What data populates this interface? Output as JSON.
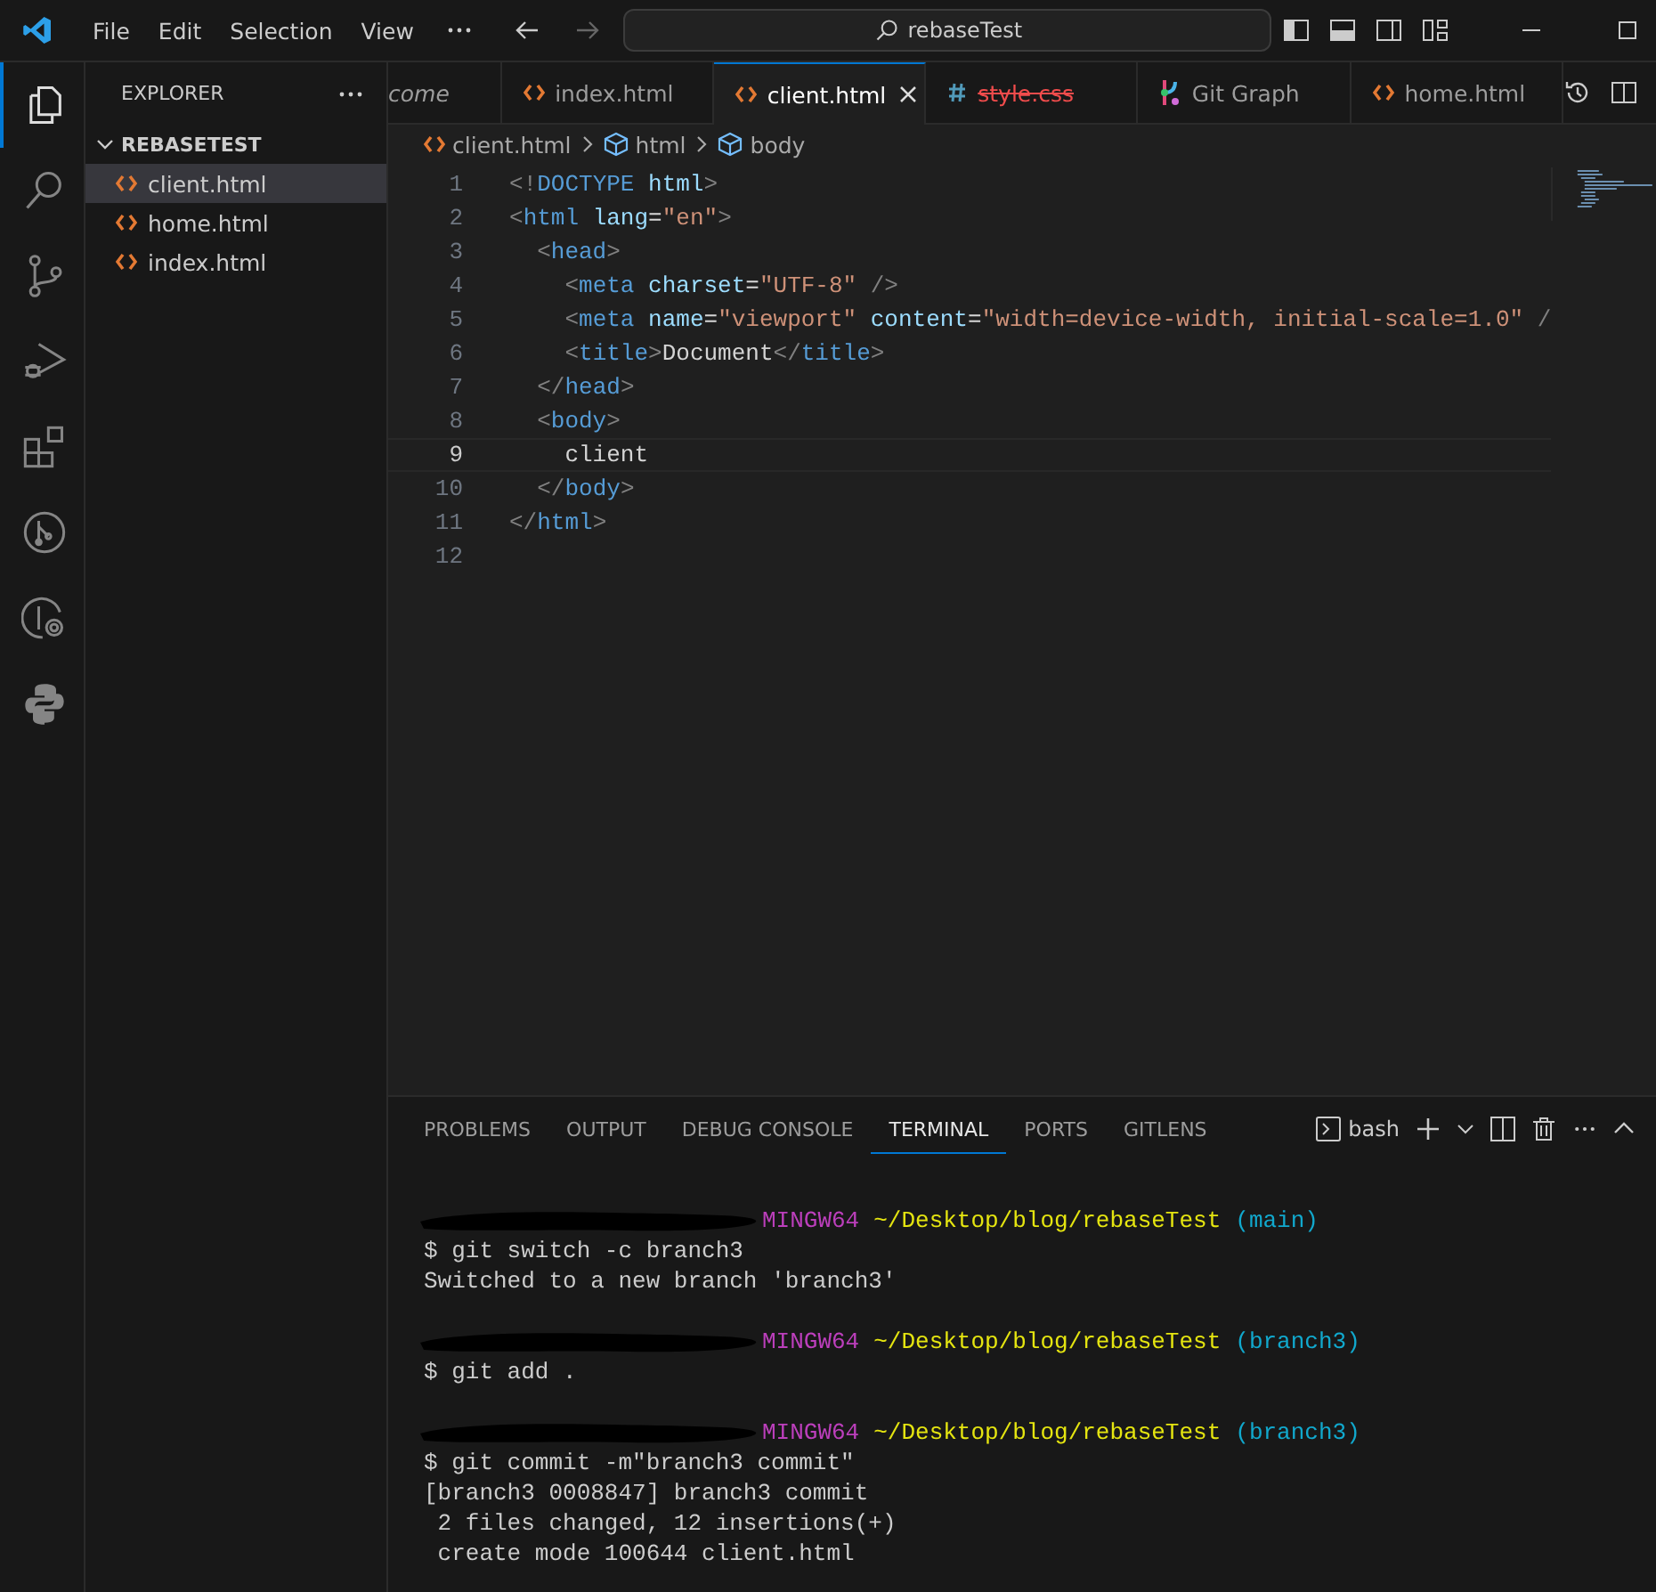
{
  "title_bar": {
    "menu": [
      "File",
      "Edit",
      "Selection",
      "View"
    ],
    "command_center": "rebaseTest"
  },
  "activity_bar": [
    {
      "kind": "explorer",
      "selected": true
    },
    {
      "kind": "search",
      "selected": false
    },
    {
      "kind": "source-control",
      "selected": false
    },
    {
      "kind": "run-debug",
      "selected": false
    },
    {
      "kind": "extensions",
      "selected": false
    },
    {
      "kind": "gitlens",
      "selected": false
    },
    {
      "kind": "gitlens-inspect",
      "selected": false
    },
    {
      "kind": "python",
      "selected": false
    }
  ],
  "sidebar": {
    "title": "EXPLORER",
    "folder": "REBASETEST",
    "expanded": true,
    "items": [
      {
        "label": "client.html",
        "selected": true
      },
      {
        "label": "home.html",
        "selected": false
      },
      {
        "label": "index.html",
        "selected": false
      }
    ]
  },
  "tabs": [
    {
      "label": "come",
      "kind": "none",
      "selected": false,
      "preview": true,
      "deleted": false
    },
    {
      "label": "index.html",
      "kind": "html",
      "selected": false,
      "preview": false,
      "deleted": false
    },
    {
      "label": "client.html",
      "kind": "html",
      "selected": true,
      "preview": false,
      "deleted": false
    },
    {
      "label": "style.css",
      "kind": "css",
      "selected": false,
      "preview": false,
      "deleted": true
    },
    {
      "label": "Git Graph",
      "kind": "graph",
      "selected": false,
      "preview": false,
      "deleted": false
    },
    {
      "label": "home.html",
      "kind": "html",
      "selected": false,
      "preview": false,
      "deleted": false
    }
  ],
  "breadcrumb": [
    {
      "label": "client.html",
      "kind": "html"
    },
    {
      "label": "html",
      "kind": "element"
    },
    {
      "label": "body",
      "kind": "element"
    }
  ],
  "code": [
    {
      "number": "1",
      "current": false,
      "tokens": [
        {
          "kind": "bracket",
          "text": "<!"
        },
        {
          "kind": "tag",
          "text": "DOCTYPE"
        },
        {
          "kind": "attribute",
          "text": " html"
        },
        {
          "kind": "bracket",
          "text": ">"
        }
      ]
    },
    {
      "number": "2",
      "current": false,
      "tokens": [
        {
          "kind": "bracket",
          "text": "<"
        },
        {
          "kind": "tag",
          "text": "html"
        },
        {
          "kind": "attribute",
          "text": " lang"
        },
        {
          "kind": "plain",
          "text": "="
        },
        {
          "kind": "string",
          "text": "\"en\""
        },
        {
          "kind": "bracket",
          "text": ">"
        }
      ]
    },
    {
      "number": "3",
      "current": false,
      "tokens": [
        {
          "kind": "bracket",
          "text": "  <"
        },
        {
          "kind": "tag",
          "text": "head"
        },
        {
          "kind": "bracket",
          "text": ">"
        }
      ]
    },
    {
      "number": "4",
      "current": false,
      "tokens": [
        {
          "kind": "bracket",
          "text": "    <"
        },
        {
          "kind": "tag",
          "text": "meta"
        },
        {
          "kind": "attribute",
          "text": " charset"
        },
        {
          "kind": "plain",
          "text": "="
        },
        {
          "kind": "string",
          "text": "\"UTF-8\""
        },
        {
          "kind": "bracket",
          "text": " />"
        }
      ]
    },
    {
      "number": "5",
      "current": false,
      "tokens": [
        {
          "kind": "bracket",
          "text": "    <"
        },
        {
          "kind": "tag",
          "text": "meta"
        },
        {
          "kind": "attribute",
          "text": " name"
        },
        {
          "kind": "plain",
          "text": "="
        },
        {
          "kind": "string",
          "text": "\"viewport\""
        },
        {
          "kind": "attribute",
          "text": " content"
        },
        {
          "kind": "plain",
          "text": "="
        },
        {
          "kind": "string",
          "text": "\"width=device-width, initial-scale=1.0\""
        },
        {
          "kind": "bracket",
          "text": " /"
        }
      ]
    },
    {
      "number": "6",
      "current": false,
      "tokens": [
        {
          "kind": "bracket",
          "text": "    <"
        },
        {
          "kind": "tag",
          "text": "title"
        },
        {
          "kind": "bracket",
          "text": ">"
        },
        {
          "kind": "plain",
          "text": "Document"
        },
        {
          "kind": "bracket",
          "text": "</"
        },
        {
          "kind": "tag",
          "text": "title"
        },
        {
          "kind": "bracket",
          "text": ">"
        }
      ]
    },
    {
      "number": "7",
      "current": false,
      "tokens": [
        {
          "kind": "bracket",
          "text": "  </"
        },
        {
          "kind": "tag",
          "text": "head"
        },
        {
          "kind": "bracket",
          "text": ">"
        }
      ]
    },
    {
      "number": "8",
      "current": false,
      "tokens": [
        {
          "kind": "bracket",
          "text": "  <"
        },
        {
          "kind": "tag",
          "text": "body"
        },
        {
          "kind": "bracket",
          "text": ">"
        }
      ]
    },
    {
      "number": "9",
      "current": true,
      "tokens": [
        {
          "kind": "plain",
          "text": "    client"
        }
      ]
    },
    {
      "number": "10",
      "current": false,
      "tokens": [
        {
          "kind": "bracket",
          "text": "  </"
        },
        {
          "kind": "tag",
          "text": "body"
        },
        {
          "kind": "bracket",
          "text": ">"
        }
      ]
    },
    {
      "number": "11",
      "current": false,
      "tokens": [
        {
          "kind": "bracket",
          "text": "</"
        },
        {
          "kind": "tag",
          "text": "html"
        },
        {
          "kind": "bracket",
          "text": ">"
        }
      ]
    },
    {
      "number": "12",
      "current": false
    }
  ],
  "panel": {
    "tabs": [
      {
        "label": "PROBLEMS",
        "selected": false
      },
      {
        "label": "OUTPUT",
        "selected": false
      },
      {
        "label": "DEBUG CONSOLE",
        "selected": false
      },
      {
        "label": "TERMINAL",
        "selected": true
      },
      {
        "label": "PORTS",
        "selected": false
      },
      {
        "label": "GITLENS",
        "selected": false
      }
    ],
    "shell": "bash",
    "terminal": [
      {
        "kind": "prompt",
        "system": "MINGW64",
        "path": "~/Desktop/blog/rebaseTest",
        "branch": "(main)"
      },
      {
        "kind": "output",
        "text": "$ git switch -c branch3"
      },
      {
        "kind": "output",
        "text": "Switched to a new branch 'branch3'"
      },
      {
        "kind": "prompt",
        "system": "MINGW64",
        "path": "~/Desktop/blog/rebaseTest",
        "branch": "(branch3)"
      },
      {
        "kind": "output",
        "text": "$ git add ."
      },
      {
        "kind": "prompt",
        "system": "MINGW64",
        "path": "~/Desktop/blog/rebaseTest",
        "branch": "(branch3)"
      },
      {
        "kind": "output",
        "text": "$ git commit -m\"branch3 commit\""
      },
      {
        "kind": "output",
        "text": "[branch3 0008847] branch3 commit"
      },
      {
        "kind": "output",
        "text": " 2 files changed, 12 insertions(+)"
      },
      {
        "kind": "output",
        "text": " create mode 100644 client.html"
      }
    ]
  }
}
